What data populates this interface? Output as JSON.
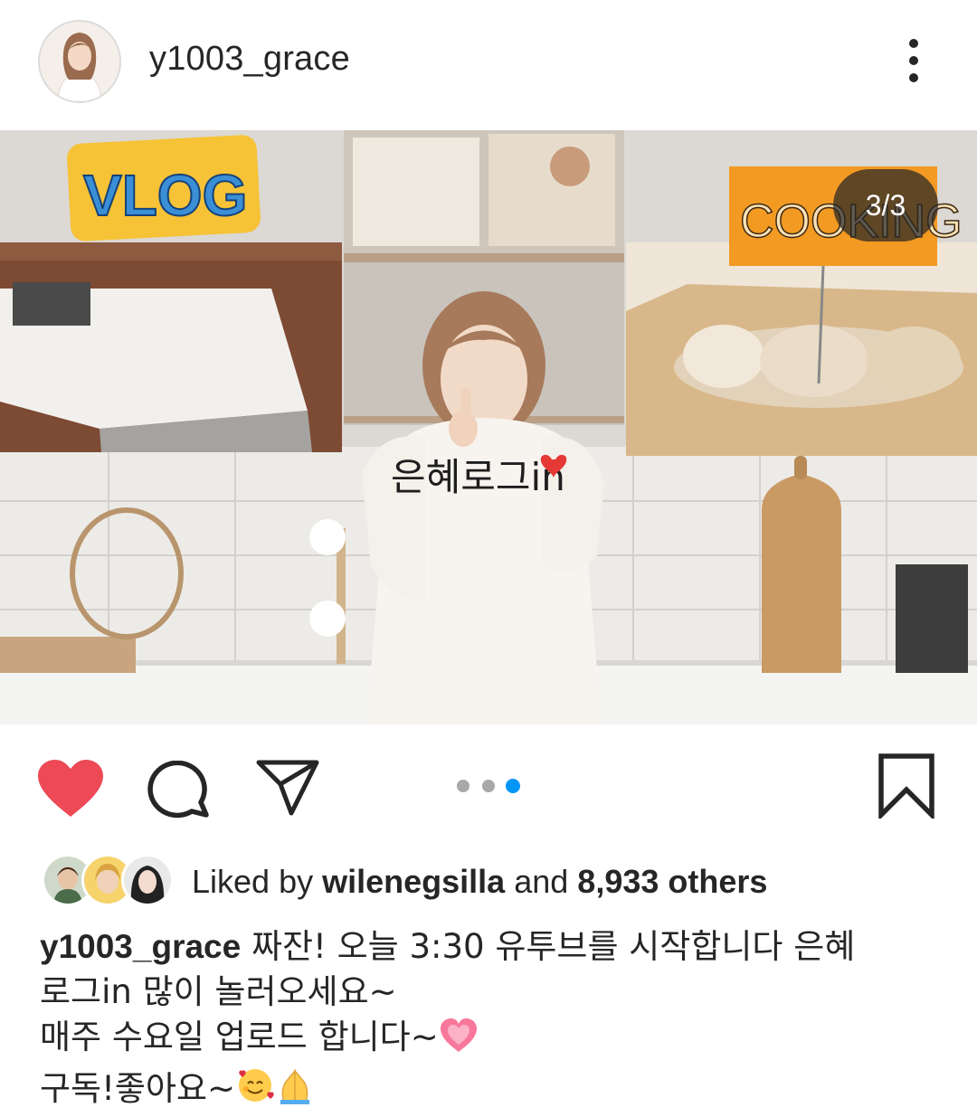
{
  "post": {
    "username": "y1003_grace",
    "image_counter": "3/3",
    "overlay_texts": {
      "vlog": "VLOG",
      "cooking": "COOKING",
      "title": "은혜로그in"
    },
    "carousel": {
      "total": 3,
      "current": 3
    }
  },
  "likes": {
    "prefix": "Liked by",
    "first_user": "wilenegsilla",
    "and": "and",
    "others": "8,933 others"
  },
  "caption": {
    "username": "y1003_grace",
    "line1": " 짜잔! 오늘 3:30 유투브를 시작합니다 은혜",
    "line2": "로그in 많이 놀러오세요~",
    "line3": "매주 수요일 업로드 합니다~",
    "line4": "구독!좋아요~"
  },
  "colors": {
    "like_red": "#ed4956",
    "active_dot": "#0095f6",
    "inactive_dot": "#a8a8a8"
  },
  "icons": [
    "more-vertical-icon",
    "heart-icon",
    "comment-icon",
    "share-icon",
    "bookmark-icon",
    "growing-heart-emoji",
    "smiling-hearts-emoji",
    "folded-hands-emoji"
  ]
}
